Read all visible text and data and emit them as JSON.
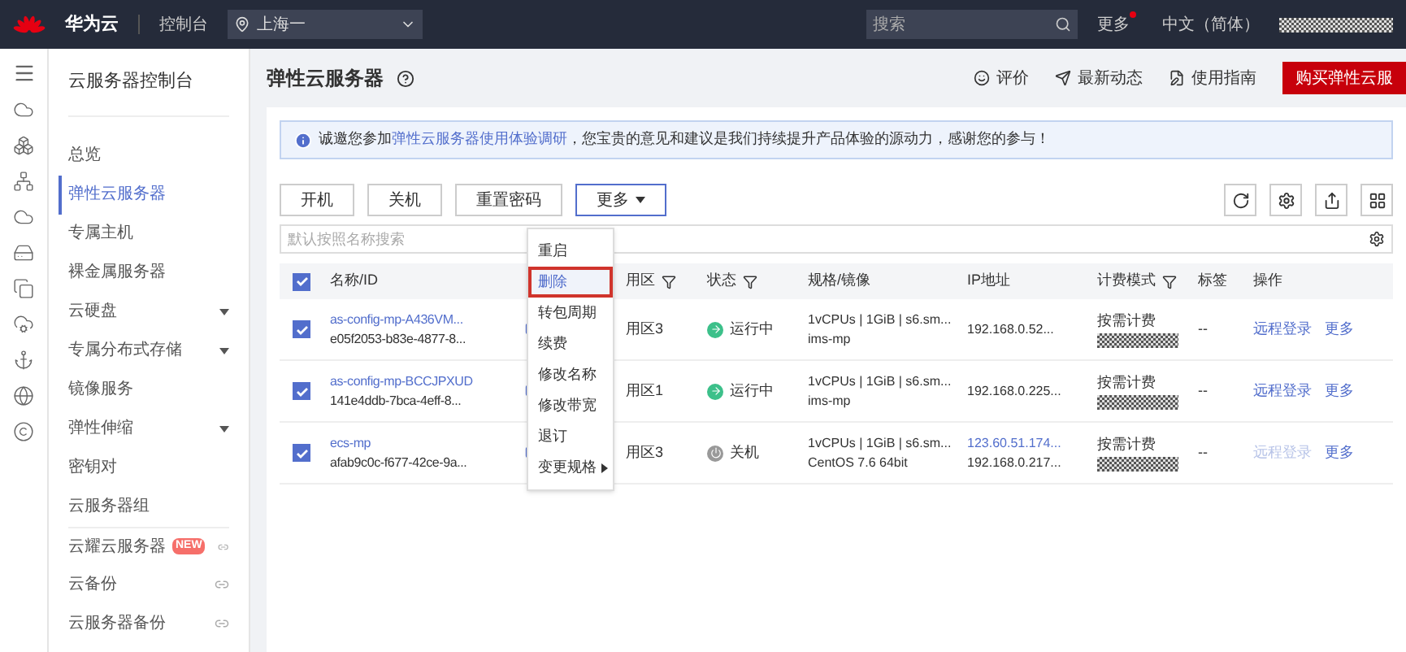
{
  "top_bar": {
    "brand": "华为云",
    "console": "控制台",
    "region": "上海一",
    "search_placeholder": "搜索",
    "more": "更多",
    "more_dot": true,
    "language": "中文（简体）"
  },
  "sidebar": {
    "title": "云服务器控制台",
    "items": [
      {
        "label": "总览",
        "selected": false,
        "expandable": false,
        "external": false
      },
      {
        "label": "弹性云服务器",
        "selected": true,
        "expandable": false,
        "external": false
      },
      {
        "label": "专属主机",
        "selected": false,
        "expandable": false,
        "external": false
      },
      {
        "label": "裸金属服务器",
        "selected": false,
        "expandable": false,
        "external": false
      },
      {
        "label": "云硬盘",
        "selected": false,
        "expandable": true,
        "external": false
      },
      {
        "label": "专属分布式存储",
        "selected": false,
        "expandable": true,
        "external": false
      },
      {
        "label": "镜像服务",
        "selected": false,
        "expandable": false,
        "external": false
      },
      {
        "label": "弹性伸缩",
        "selected": false,
        "expandable": true,
        "external": false
      },
      {
        "label": "密钥对",
        "selected": false,
        "expandable": false,
        "external": false
      },
      {
        "label": "云服务器组",
        "selected": false,
        "expandable": false,
        "external": false
      },
      {
        "label": "云耀云服务器",
        "badge": "NEW",
        "selected": false,
        "expandable": false,
        "external": true
      },
      {
        "label": "云备份",
        "selected": false,
        "expandable": false,
        "external": true
      },
      {
        "label": "云服务器备份",
        "selected": false,
        "expandable": false,
        "external": true
      }
    ]
  },
  "page": {
    "title": "弹性云服务器",
    "links": [
      {
        "kind": "rate",
        "label": "评价"
      },
      {
        "kind": "news",
        "label": "最新动态"
      },
      {
        "kind": "guide",
        "label": "使用指南"
      }
    ],
    "buy_button": "购买弹性云服"
  },
  "notice": {
    "before": "诚邀您参加",
    "link": "弹性云服务器使用体验调研",
    "after": "，您宝贵的意见和建议是我们持续提升产品体验的源动力，感谢您的参与！"
  },
  "toolbar": {
    "buttons": [
      "开机",
      "关机",
      "重置密码"
    ],
    "more": "更多",
    "search_placeholder": "默认按照名称搜索"
  },
  "more_menu": [
    {
      "label": "重启",
      "selected": false,
      "submenu": false
    },
    {
      "label": "删除",
      "selected": true,
      "submenu": false
    },
    {
      "label": "转包周期",
      "selected": false,
      "submenu": false
    },
    {
      "label": "续费",
      "selected": false,
      "submenu": false
    },
    {
      "label": "修改名称",
      "selected": false,
      "submenu": false
    },
    {
      "label": "修改带宽",
      "selected": false,
      "submenu": false
    },
    {
      "label": "退订",
      "selected": false,
      "submenu": false
    },
    {
      "label": "变更规格",
      "selected": false,
      "submenu": true
    }
  ],
  "table": {
    "all_checked": true,
    "columns": [
      {
        "label": "名称/ID",
        "filter": false
      },
      {
        "label": "用区",
        "filter": true
      },
      {
        "label": "状态",
        "filter": true
      },
      {
        "label": "规格/镜像",
        "filter": false
      },
      {
        "label": "IP地址",
        "filter": false
      },
      {
        "label": "计费模式",
        "filter": true
      },
      {
        "label": "标签",
        "filter": false
      },
      {
        "label": "操作",
        "filter": false
      }
    ],
    "rows": [
      {
        "checked": true,
        "name": "as-config-mp-A436VM...",
        "id": "e05f2053-b83e-4877-8...",
        "zone": "用区3",
        "status": {
          "kind": "running",
          "label": "运行中"
        },
        "spec": "1vCPUs | 1GiB | s6.sm...",
        "image": "ims-mp",
        "ips": [
          "192.168.0.52..."
        ],
        "billing": "按需计费",
        "tag": "--",
        "login": "远程登录",
        "login_disabled": false,
        "more": "更多"
      },
      {
        "checked": true,
        "name": "as-config-mp-BCCJPXUD",
        "id": "141e4ddb-7bca-4eff-8...",
        "zone": "用区1",
        "status": {
          "kind": "running",
          "label": "运行中"
        },
        "spec": "1vCPUs | 1GiB | s6.sm...",
        "image": "ims-mp",
        "ips": [
          "192.168.0.225..."
        ],
        "billing": "按需计费",
        "tag": "--",
        "login": "远程登录",
        "login_disabled": false,
        "more": "更多"
      },
      {
        "checked": true,
        "name": "ecs-mp",
        "id": "afab9c0c-f677-42ce-9a...",
        "zone": "用区3",
        "status": {
          "kind": "stopped",
          "label": "关机"
        },
        "spec": "1vCPUs | 1GiB | s6.sm...",
        "image": "CentOS 7.6 64bit",
        "ips": [
          "123.60.51.174...",
          "192.168.0.217..."
        ],
        "billing": "按需计费",
        "tag": "--",
        "login": "远程登录",
        "login_disabled": true,
        "more": "更多"
      }
    ]
  }
}
